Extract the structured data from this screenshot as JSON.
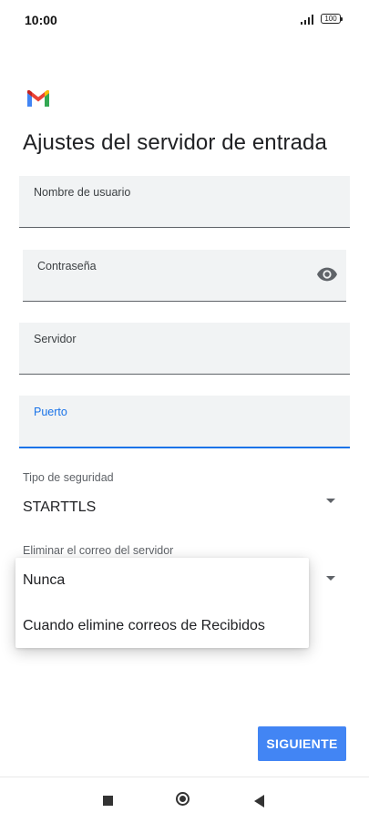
{
  "status_bar": {
    "time": "10:00",
    "battery": "100"
  },
  "page": {
    "title": "Ajustes del servidor de entrada"
  },
  "fields": {
    "username": {
      "label": "Nombre de usuario",
      "value": ""
    },
    "password": {
      "label": "Contraseña",
      "value": ""
    },
    "server": {
      "label": "Servidor",
      "value": ""
    },
    "port": {
      "label": "Puerto",
      "value": "",
      "focused": true
    }
  },
  "security": {
    "label": "Tipo de seguridad",
    "selected": "STARTTLS"
  },
  "delete_from_server": {
    "label": "Eliminar el correo del servidor",
    "options": [
      "Nunca",
      "Cuando elimine correos de Recibidos"
    ]
  },
  "actions": {
    "next_label": "SIGUIENTE"
  },
  "colors": {
    "accent": "#1a73e8",
    "button": "#4285f4",
    "field_bg": "#f1f3f4"
  },
  "icons": [
    "gmail-logo-icon",
    "eye-icon",
    "chevron-down-icon",
    "recents-icon",
    "home-icon",
    "back-icon"
  ]
}
